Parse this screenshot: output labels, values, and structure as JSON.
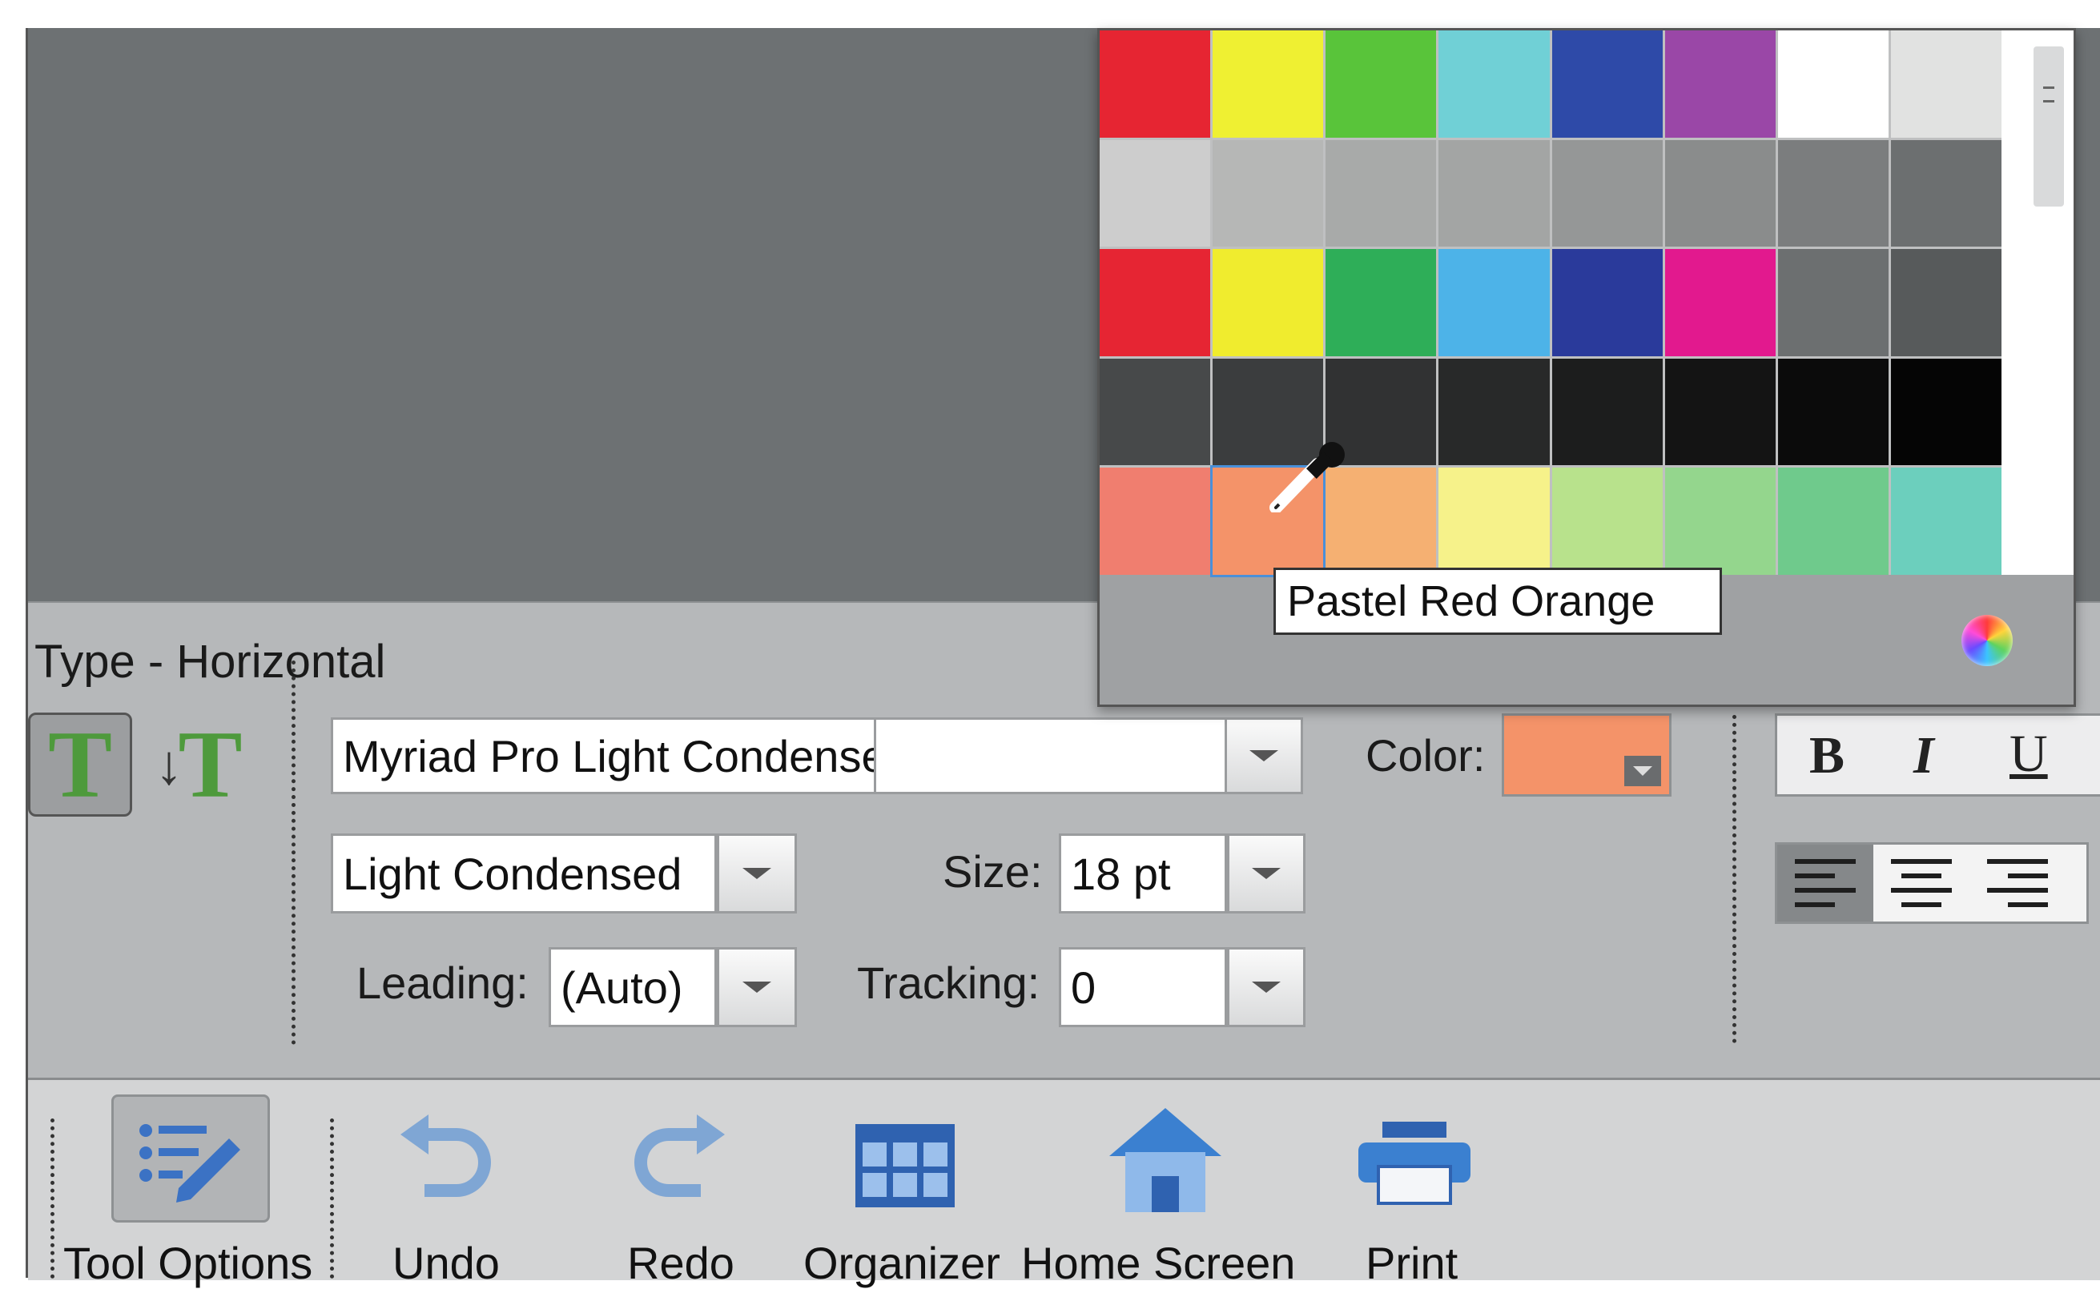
{
  "panel": {
    "title": "Type - Horizontal"
  },
  "type_tools": {
    "horizontal_glyph": "T",
    "vertical_glyph": "T"
  },
  "font": {
    "family": "Myriad Pro Light Condensed",
    "style": "Light Condensed",
    "leading_label": "Leading:",
    "leading": "(Auto)",
    "size_label": "Size:",
    "size": "18 pt",
    "tracking_label": "Tracking:",
    "tracking": "0"
  },
  "color": {
    "label": "Color:",
    "value": "#f49369"
  },
  "format": {
    "bold": "B",
    "italic": "I",
    "underline": "U"
  },
  "swatch_popup": {
    "tooltip": "Pastel Red Orange",
    "swatches": [
      [
        "#e62532",
        "#eff032",
        "#59c43a",
        "#70d0d6",
        "#2e4aa8",
        "#9a47a7",
        "#ffffff",
        "#e1e2e1"
      ],
      [
        "#cdcdcd",
        "#b6b7b6",
        "#a8aaa9",
        "#a3a5a4",
        "#959797",
        "#8a8c8c",
        "#7b7d7e",
        "#6c6f70"
      ],
      [
        "#e62533",
        "#f0ec2e",
        "#2eae58",
        "#4db3e8",
        "#2a3a9b",
        "#e2198e",
        "#6c6f70",
        "#575a5b"
      ],
      [
        "#47494a",
        "#3b3d3e",
        "#313233",
        "#282929",
        "#1c1d1d",
        "#141414",
        "#0b0b0b",
        "#050505"
      ],
      [
        "#f07e6f",
        "#f49369",
        "#f5b072",
        "#f6f28a",
        "#b8e28c",
        "#94d68d",
        "#6fca8c",
        "#6ccfbd"
      ]
    ]
  },
  "taskbar": {
    "tool_options": "Tool Options",
    "undo": "Undo",
    "redo": "Redo",
    "organizer": "Organizer",
    "home_screen": "Home Screen",
    "print": "Print"
  }
}
